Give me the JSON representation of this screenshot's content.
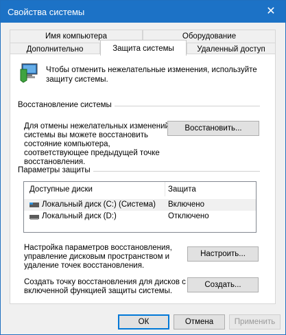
{
  "window": {
    "title": "Свойства системы",
    "close_glyph": "✕"
  },
  "tabs": {
    "back_row": [
      "Имя компьютера",
      "Оборудование"
    ],
    "front_row": [
      "Дополнительно",
      "Защита системы",
      "Удаленный доступ"
    ],
    "active": "Защита системы"
  },
  "intro": {
    "text_line1": "Чтобы отменить нежелательные изменения, используйте",
    "text_line2": "защиту системы.",
    "icon": "system-protection-icon"
  },
  "restore": {
    "group_title": "Восстановление системы",
    "desc_lines": [
      "Для отмены нежелательных изменений",
      "системы вы можете восстановить",
      "состояние компьютера,",
      "соответствующее предыдущей точке",
      "восстановления."
    ],
    "button": "Восстановить..."
  },
  "protection": {
    "group_title": "Параметры защиты",
    "columns": [
      "Доступные диски",
      "Защита"
    ],
    "rows": [
      {
        "name": "Локальный диск (C:) (Система)",
        "status": "Включено",
        "icon": "system-drive-icon"
      },
      {
        "name": "Локальный диск (D:)",
        "status": "Отключено",
        "icon": "drive-icon"
      }
    ],
    "configure_lines": [
      "Настройка параметров восстановления,",
      "управление дисковым пространством и",
      "удаление точек восстановления."
    ],
    "configure_button": "Настроить...",
    "create_lines": [
      "Создать точку восстановления для дисков с",
      "включенной функцией защиты системы."
    ],
    "create_button": "Создать..."
  },
  "footer": {
    "ok": "ОК",
    "cancel": "Отмена",
    "apply": "Применить"
  },
  "colors": {
    "titlebar": "#1c72c6",
    "focus": "#0078d7"
  }
}
